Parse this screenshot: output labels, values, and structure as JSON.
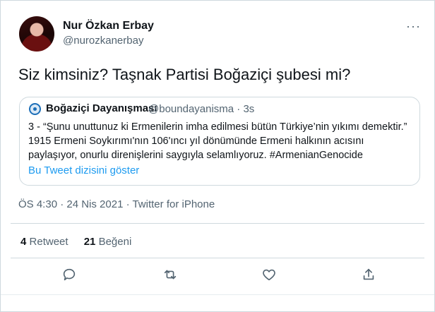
{
  "author": {
    "name": "Nur Özkan Erbay",
    "handle": "@nurozkanerbay"
  },
  "menu": {
    "more_label": "···"
  },
  "tweet": {
    "text": "Siz kimsiniz? Taşnak Partisi Boğaziçi şubesi mi?"
  },
  "quote": {
    "name": "Boğaziçi Dayanışması",
    "handle": "@boundayanisma · 3s",
    "body": "3 - “Şunu unuttunuz ki Ermenilerin imha edilmesi bütün Türkiye’nin yıkımı demektir.” 1915 Ermeni Soykırımı'nın 106'ıncı yıl dönümünde Ermeni halkının acısını paylaşıyor, onurlu direnişlerini saygıyla selamlıyoruz. #ArmenianGenocide",
    "link": "Bu Tweet dizisini göster"
  },
  "meta": {
    "text": "ÖS 4:30 · 24 Nis 2021 · Twitter for iPhone"
  },
  "stats": {
    "retweets_count": "4",
    "retweets_label": "Retweet",
    "likes_count": "21",
    "likes_label": "Beğeni"
  },
  "actions": [
    "reply-icon",
    "retweet-icon",
    "like-icon",
    "share-icon"
  ],
  "colors": {
    "link": "#1d9bf0",
    "secondary_text": "#536471",
    "border": "#cfd9de"
  }
}
